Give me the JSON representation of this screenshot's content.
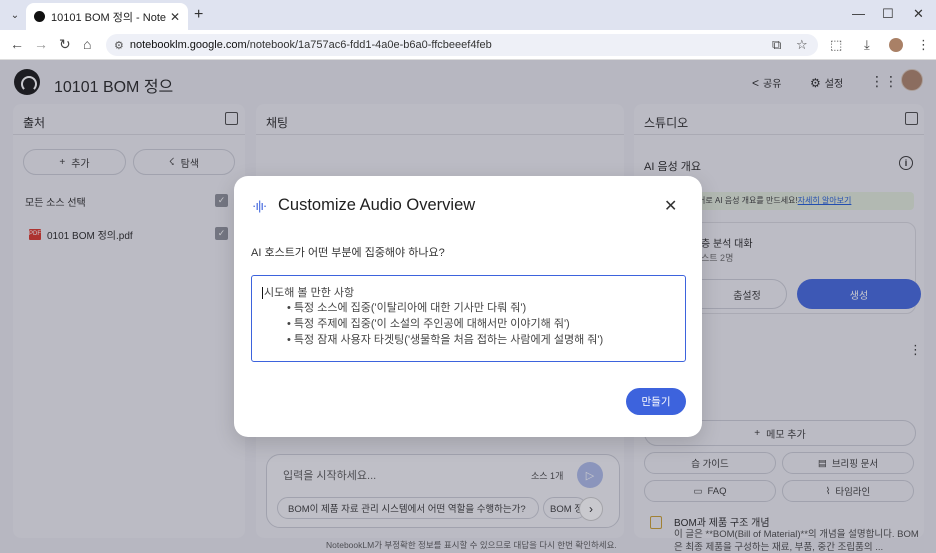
{
  "browser": {
    "tab_title": "10101 BOM 정의 - NotebookL",
    "url_host": "notebooklm.google.com",
    "url_path": "/notebook/1a757ac6-fdd1-4a0e-b6a0-ffcbeeef4feb"
  },
  "header": {
    "title": "10101 BOM 정으",
    "share_label": "공유",
    "settings_label": "설정"
  },
  "sources": {
    "title": "출처",
    "add_label": "추가",
    "explore_label": "탐색",
    "select_all_label": "모든 소스 선택",
    "items": [
      {
        "name": "0101 BOM 정의.pdf"
      }
    ]
  },
  "chat": {
    "title": "채팅",
    "input_placeholder": "입력을 시작하세요...",
    "source_count": "소스 1개",
    "suggestions": [
      "BOM이 제품 자료 관리 시스템에서 어떤 역할을 수행하는가?",
      "BOM 정"
    ],
    "disclaimer": "NotebookLM가 부정확한 정보를 표시할 수 있으므로 대답을 다시 한번 확인하세요."
  },
  "studio": {
    "title": "스튜디오",
    "audio_overview_label": "AI 음성 개요",
    "lang_banner": "어로 AI 음성 개요를 만드세요!",
    "lang_banner_link": "자세히 알아보기",
    "audio_card_title": "층 분석 대화",
    "audio_card_sub": "스트 2명",
    "customize_label": "춤설정",
    "generate_label": "생성",
    "add_note_label": "메모 추가",
    "pills": [
      "습 가이드",
      "브리핑 문서",
      "FAQ",
      "타임라인"
    ],
    "note_title": "BOM과 제품 구조 개념",
    "note_desc": "이 글은 **BOM(Bill of Material)**의 개념을 설명합니다. BOM은 최종 제품을 구성하는 재료, 부품, 중간 조립품의 ..."
  },
  "dialog": {
    "title": "Customize Audio Overview",
    "question": "AI 호스트가 어떤 부분에 집중해야 하나요?",
    "placeholder_head": "시도해 볼 만한 사항",
    "placeholder_items": [
      "특정 소스에 집중('이탈리아에 대한 기사만 다뤄 줘')",
      "특정 주제에 집중('이 소설의 주인공에 대해서만 이야기해 줘')",
      "특정 잠재 사용자 타겟팅('생물학을 처음 접하는 사람에게 설명해 줘')"
    ],
    "make_label": "만들기"
  }
}
